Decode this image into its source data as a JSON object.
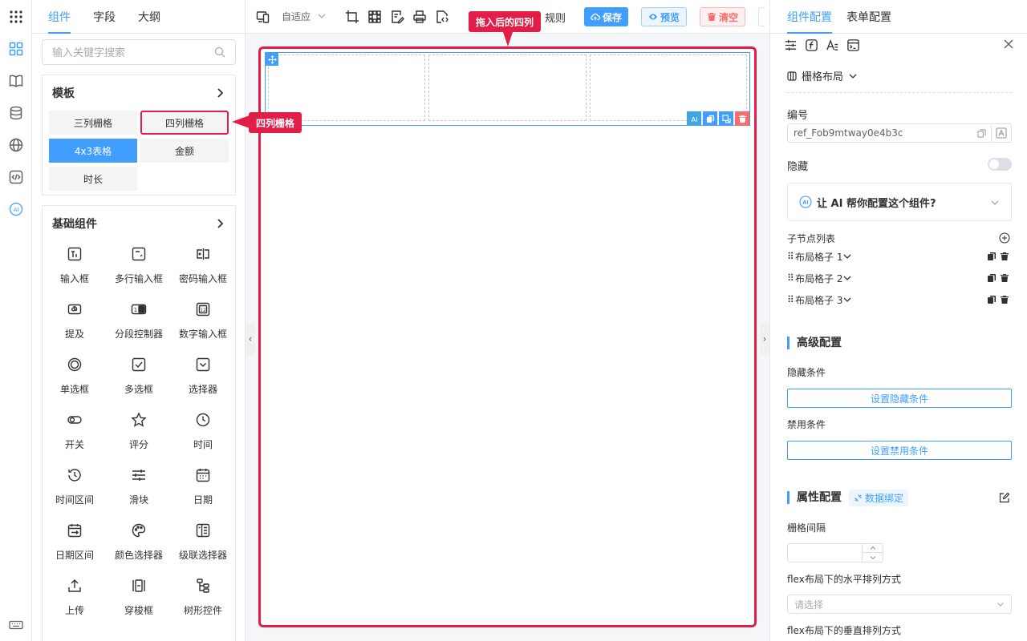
{
  "left_tabs": [
    "组件",
    "字段",
    "大纲"
  ],
  "search": {
    "placeholder": "输入关键字搜索"
  },
  "templates": {
    "title": "模板",
    "items": [
      "三列栅格",
      "四列栅格",
      "4x3表格",
      "金额",
      "时长"
    ]
  },
  "basic": {
    "title": "基础组件",
    "items": [
      {
        "label": "输入框",
        "icon": "input-icon"
      },
      {
        "label": "多行输入框",
        "icon": "textarea-icon"
      },
      {
        "label": "密码输入框",
        "icon": "password-icon"
      },
      {
        "label": "提及",
        "icon": "mention-icon"
      },
      {
        "label": "分段控制器",
        "icon": "segmented-icon"
      },
      {
        "label": "数字输入框",
        "icon": "number-icon"
      },
      {
        "label": "单选框",
        "icon": "radio-icon"
      },
      {
        "label": "多选框",
        "icon": "checkbox-icon"
      },
      {
        "label": "选择器",
        "icon": "select-icon"
      },
      {
        "label": "开关",
        "icon": "switch-icon"
      },
      {
        "label": "评分",
        "icon": "star-icon"
      },
      {
        "label": "时间",
        "icon": "clock-icon"
      },
      {
        "label": "时间区间",
        "icon": "history-icon"
      },
      {
        "label": "滑块",
        "icon": "slider-icon"
      },
      {
        "label": "日期",
        "icon": "calendar-icon"
      },
      {
        "label": "日期区间",
        "icon": "date-range-icon"
      },
      {
        "label": "颜色选择器",
        "icon": "palette-icon"
      },
      {
        "label": "级联选择器",
        "icon": "cascader-icon"
      },
      {
        "label": "上传",
        "icon": "upload-icon"
      },
      {
        "label": "穿梭框",
        "icon": "transfer-icon"
      },
      {
        "label": "树形控件",
        "icon": "tree-icon"
      }
    ]
  },
  "toolbar": {
    "adapt": "自适应",
    "rules": "规则",
    "save": "保存",
    "preview": "预览",
    "clear": "清空"
  },
  "callouts": {
    "dragged": "拖入后的四列",
    "four_col": "四列栅格"
  },
  "right_tabs": [
    "组件配置",
    "表单配置"
  ],
  "props": {
    "component_type": "栅格布局",
    "id_label": "编号",
    "id_value": "ref_Fob9mtway0e4b3c",
    "hidden_label": "隐藏",
    "ai_prompt": "让 AI 帮你配置这个组件?",
    "children_label": "子节点列表",
    "children": [
      "布局格子 1",
      "布局格子 2",
      "布局格子 3"
    ],
    "advanced_title": "高级配置",
    "hide_cond_label": "隐藏条件",
    "hide_cond_btn": "设置隐藏条件",
    "disable_cond_label": "禁用条件",
    "disable_cond_btn": "设置禁用条件",
    "attr_title": "属性配置",
    "data_binding": "数据绑定",
    "gutter_label": "栅格间隔",
    "justify_label": "flex布局下的水平排列方式",
    "justify_placeholder": "请选择",
    "align_label": "flex布局下的垂直排列方式"
  },
  "colors": {
    "primary": "#409eff",
    "annotation": "#e11d48",
    "danger": "#f56c6c"
  }
}
